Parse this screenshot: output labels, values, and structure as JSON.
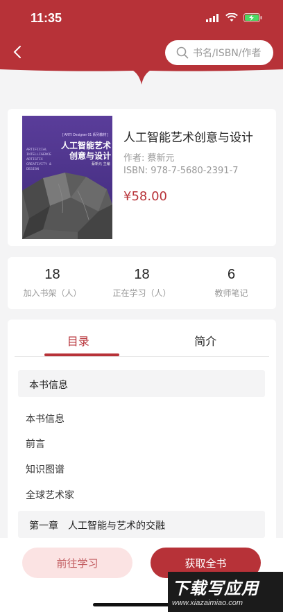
{
  "status_bar": {
    "time": "11:35"
  },
  "header": {
    "search_placeholder": "书名/ISBN/作者"
  },
  "book": {
    "title": "人工智能艺术创意与设计",
    "author": "作者:  蔡新元",
    "isbn": "ISBN:  978-7-5680-2391-7",
    "price": "¥58.00",
    "cover": {
      "tag": "[ ARTI Designer 01 系列教材 ]",
      "title": "人工智能艺术创意与设计",
      "english": "ARTIFICIAL INTELLIGENCE ARTISTIC CREATIVITY & DESIGN",
      "author": "蔡新元 主编"
    }
  },
  "stats": [
    {
      "value": "18",
      "label": "加入书架（人）"
    },
    {
      "value": "18",
      "label": "正在学习（人）"
    },
    {
      "value": "6",
      "label": "教师笔记"
    }
  ],
  "tabs": {
    "catalog": "目录",
    "intro": "简介"
  },
  "catalog": {
    "section1": "本书信息",
    "items": [
      "本书信息",
      "前言",
      "知识图谱",
      "全球艺术家"
    ],
    "chapter1": "第一章　人工智能与艺术的交融"
  },
  "actions": {
    "study": "前往学习",
    "get_book": "获取全书"
  },
  "watermark": {
    "main": "下载写应用",
    "url": "www.xiazaimiao.com"
  },
  "colors": {
    "primary": "#b73238",
    "secondary_bg": "#fbe3e3"
  }
}
